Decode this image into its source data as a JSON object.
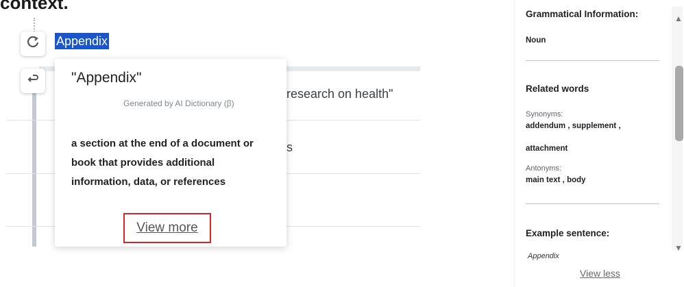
{
  "heading": "context.",
  "selected_word": "Appendix",
  "toolbar": {
    "refresh_icon": "refresh-icon",
    "undo_icon": "undo-icon"
  },
  "doc": {
    "row1_text": "research on health\"",
    "row2_text": "s"
  },
  "popup": {
    "title": "\"Appendix\"",
    "generated_by": "Generated by AI Dictionary (β)",
    "definition": "a section at the end of a document or book that provides additional information, data, or references",
    "view_more": "View more"
  },
  "panel": {
    "grammatical_heading": "Grammatical Information:",
    "part_of_speech": "Noun",
    "related_heading": "Related words",
    "synonyms_label": "Synonyms:",
    "synonyms_line1": "addendum ,  supplement ,",
    "synonyms_line2": "attachment",
    "antonyms_label": "Antonyms:",
    "antonyms": "main text ,  body",
    "example_heading": "Example sentence:",
    "example_text": "Appendix",
    "view_less": "View less"
  },
  "colors": {
    "selection": "#1a56c9",
    "highlight_border": "#d9232b"
  }
}
